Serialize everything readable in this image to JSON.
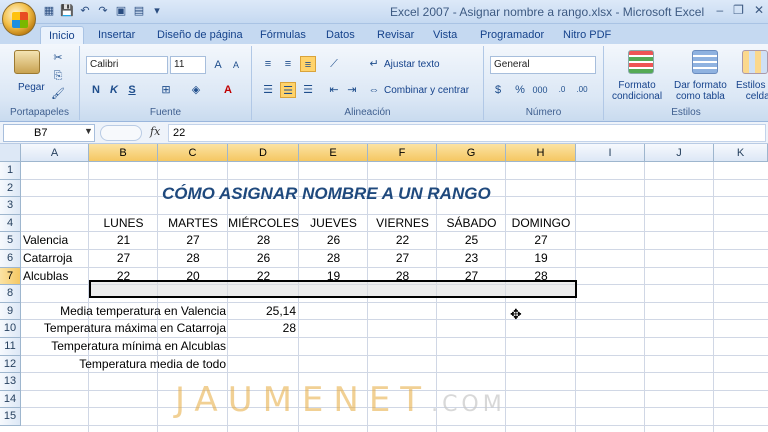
{
  "window": {
    "title": "Excel 2007 - Asignar nombre a rango.xlsx - Microsoft Excel",
    "controls": [
      "–",
      "❐",
      "✕"
    ]
  },
  "tabs": [
    "Inicio",
    "Insertar",
    "Diseño de página",
    "Fórmulas",
    "Datos",
    "Revisar",
    "Vista",
    "Programador",
    "Nitro PDF"
  ],
  "ribbon": {
    "portapapeles": {
      "paste_label": "Pegar",
      "group_label": "Portapapeles"
    },
    "fuente": {
      "font_name": "Calibri",
      "font_size": "11",
      "group_label": "Fuente",
      "bold": "N",
      "italic": "K",
      "underline": "S"
    },
    "alineacion": {
      "wrap_label": "Ajustar texto",
      "merge_label": "Combinar y centrar",
      "group_label": "Alineación"
    },
    "numero": {
      "format_value": "General",
      "group_label": "Número"
    },
    "estilos": {
      "cond_format_line1": "Formato",
      "cond_format_line2": "condicional",
      "table_format_line1": "Dar formato",
      "table_format_line2": "como tabla",
      "cell_styles_line1": "Estilos de",
      "cell_styles_line2": "celda",
      "group_label": "Estilos"
    }
  },
  "formula_bar": {
    "name_box": "B7",
    "fx": "fx",
    "value": "22"
  },
  "columns": [
    "A",
    "B",
    "C",
    "D",
    "E",
    "F",
    "G",
    "H",
    "I",
    "J",
    "K"
  ],
  "rows": [
    "1",
    "2",
    "3",
    "4",
    "5",
    "6",
    "7",
    "8",
    "9",
    "10",
    "11",
    "12",
    "13",
    "14",
    "15"
  ],
  "sheet": {
    "title": "CÓMO ASIGNAR NOMBRE A UN RANGO",
    "days": [
      "LUNES",
      "MARTES",
      "MIÉRCOLES",
      "JUEVES",
      "VIERNES",
      "SÁBADO",
      "DOMINGO"
    ],
    "cities": [
      {
        "name": "Valencia",
        "values": [
          "21",
          "27",
          "28",
          "26",
          "22",
          "25",
          "27"
        ]
      },
      {
        "name": "Catarroja",
        "values": [
          "27",
          "28",
          "26",
          "28",
          "27",
          "23",
          "19"
        ]
      },
      {
        "name": "Alcublas",
        "values": [
          "22",
          "20",
          "22",
          "19",
          "28",
          "27",
          "28"
        ]
      }
    ],
    "stats": [
      {
        "label": "Media temperatura en Valencia",
        "value": "25,14"
      },
      {
        "label": "Temperatura máxima en Catarroja",
        "value": "28"
      },
      {
        "label": "Temperatura mínima en Alcublas",
        "value": ""
      },
      {
        "label": "Temperatura media de todo",
        "value": ""
      }
    ]
  },
  "watermark": {
    "main": "JAUMENET",
    "suffix": ".COM"
  }
}
